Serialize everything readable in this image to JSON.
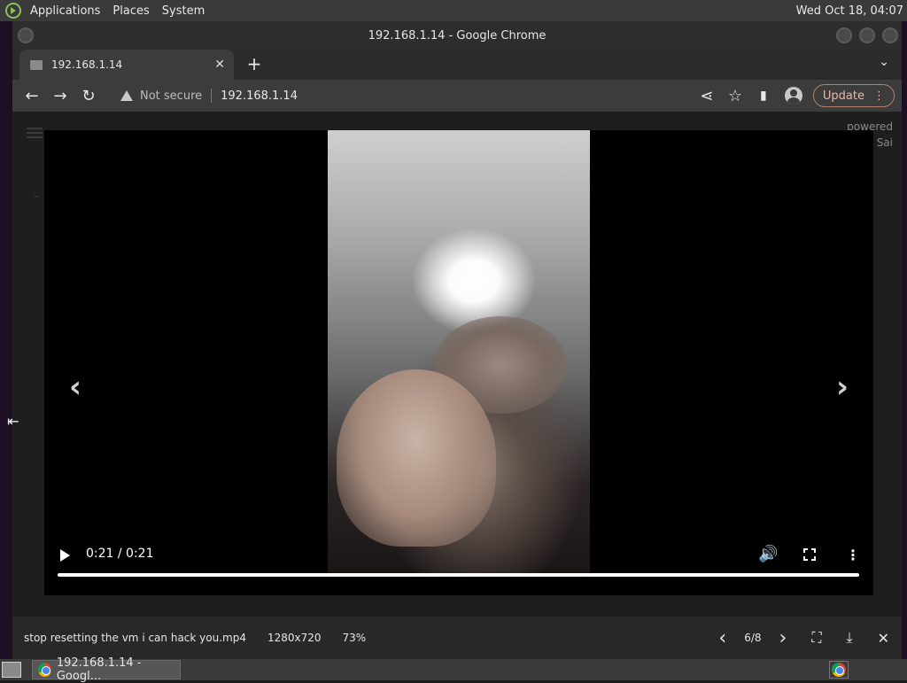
{
  "top_panel": {
    "menus": [
      "Applications",
      "Places",
      "System"
    ],
    "clock": "Wed Oct 18, 04:07"
  },
  "window": {
    "title": "192.168.1.14 - Google Chrome"
  },
  "tab": {
    "title": "192.168.1.14",
    "close": "✕",
    "new_tab": "+",
    "tab_menu": "⌄"
  },
  "toolbar": {
    "back": "←",
    "forward": "→",
    "reload": "↻",
    "security_label": "Not secure",
    "url": "192.168.1.14",
    "share": "⋖",
    "bookmark": "☆",
    "side_panel": "▮",
    "update_label": "Update",
    "menu": "⋮"
  },
  "page": {
    "powered_line1": "powered",
    "powered_line2": "Sai",
    "bg_chevron": "⌄"
  },
  "viewer": {
    "prev": "‹",
    "next": "›",
    "time": "0:21 / 0:21",
    "volume_icon": "🔊",
    "more": "⋮",
    "progress": 1.0
  },
  "infobar": {
    "filename": "stop resetting the vm i can hack you.mp4",
    "resolution": "1280x720",
    "zoom": "73%",
    "prev": "‹",
    "position": "6/8",
    "next": "›",
    "fullscreen": "⛶",
    "download": "⤓",
    "close": "✕"
  },
  "taskbar": {
    "task_label": "192.168.1.14 - Googl..."
  },
  "cursor": "⇤"
}
